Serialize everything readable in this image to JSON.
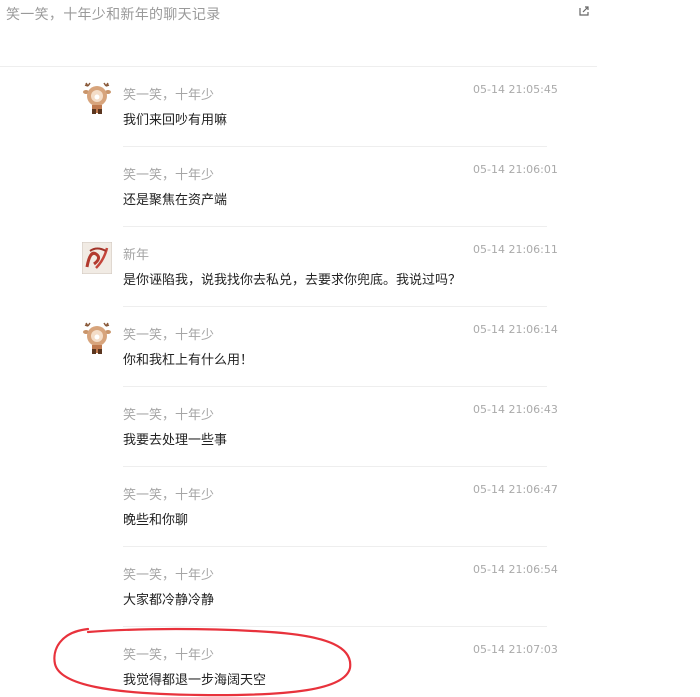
{
  "page": {
    "title": "笑一笑，十年少和新年的聊天记录"
  },
  "messages": [
    {
      "sender": "笑一笑，十年少",
      "time": "05-14 21:05:45",
      "text": "我们来回吵有用嘛",
      "avatar": "deer-avatar"
    },
    {
      "sender": "笑一笑，十年少",
      "time": "05-14 21:06:01",
      "text": "还是聚焦在资产端",
      "avatar": ""
    },
    {
      "sender": "新年",
      "time": "05-14 21:06:11",
      "text": "是你诬陷我，说我找你去私兑，去要求你兜底。我说过吗？",
      "avatar": "calligraphy-avatar"
    },
    {
      "sender": "笑一笑，十年少",
      "time": "05-14 21:06:14",
      "text": "你和我杠上有什么用！",
      "avatar": "deer-avatar"
    },
    {
      "sender": "笑一笑，十年少",
      "time": "05-14 21:06:43",
      "text": "我要去处理一些事",
      "avatar": ""
    },
    {
      "sender": "笑一笑，十年少",
      "time": "05-14 21:06:47",
      "text": "晚些和你聊",
      "avatar": ""
    },
    {
      "sender": "笑一笑，十年少",
      "time": "05-14 21:06:54",
      "text": "大家都冷静冷静",
      "avatar": ""
    },
    {
      "sender": "笑一笑，十年少",
      "time": "05-14 21:07:03",
      "text": "我觉得都退一步海阔天空",
      "avatar": ""
    }
  ],
  "icons": {
    "share": "share-icon"
  },
  "colors": {
    "annotation": "#e8323c",
    "timestamp": "#aaaaaa",
    "sender": "#a5a5a5",
    "message_text": "#222222"
  }
}
